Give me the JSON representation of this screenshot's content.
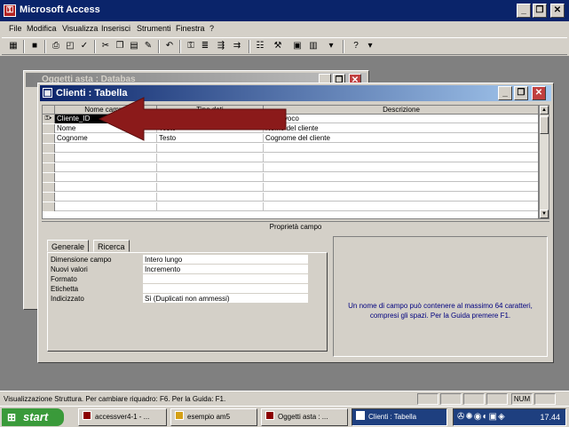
{
  "app": {
    "title": "Microsoft Access",
    "controls": {
      "minimize": "_",
      "restore": "❐",
      "close": "✕"
    }
  },
  "menu": [
    "File",
    "Modifica",
    "Visualizza",
    "Inserisci",
    "Strumenti",
    "Finestra",
    "?"
  ],
  "toolbar_icons": [
    "view-design-icon",
    "save-icon",
    "print-icon",
    "print-preview-icon",
    "spelling-icon",
    "cut-icon",
    "copy-icon",
    "paste-icon",
    "format-painter-icon",
    "undo-icon",
    "primary-key-icon",
    "indexes-icon",
    "insert-rows-icon",
    "delete-rows-icon",
    "properties-icon",
    "build-icon",
    "database-window-icon",
    "new-object-icon",
    "help-icon"
  ],
  "db_window": {
    "title": "Oggetti asta : Databas"
  },
  "table_window": {
    "title": "Clienti : Tabella",
    "columns": [
      "Nome campo",
      "Tipo dati",
      "Descrizione"
    ],
    "rows": [
      {
        "name": "Cliente_ID",
        "type": "",
        "description": "ID univoco",
        "key": true
      },
      {
        "name": "Nome",
        "type": "Testo",
        "description": "Nome del cliente",
        "key": false
      },
      {
        "name": "Cognome",
        "type": "Testo",
        "description": "Cognome del cliente",
        "key": false
      }
    ],
    "properties_label": "Proprietà campo",
    "tabs": [
      "Generale",
      "Ricerca"
    ],
    "properties": [
      {
        "label": "Dimensione campo",
        "value": "Intero lungo"
      },
      {
        "label": "Nuovi valori",
        "value": "Incremento"
      },
      {
        "label": "Formato",
        "value": ""
      },
      {
        "label": "Etichetta",
        "value": ""
      },
      {
        "label": "Indicizzato",
        "value": "Sì (Duplicati non ammessi)"
      }
    ],
    "help_text": "Un nome di campo può contenere al massimo 64 caratteri, compresi gli spazi. Per la Guida premere F1."
  },
  "status": {
    "text": "Visualizzazione Struttura. Per cambiare riquadro: F6. Per la Guida: F1.",
    "num": "NUM"
  },
  "taskbar": {
    "start": "start",
    "tasks": [
      "accessver4-1 - ...",
      "esempio am5",
      "Oggetti asta : ...",
      "Clienti : Tabella"
    ],
    "clock": "17.44"
  },
  "colors": {
    "desktop": "#008080",
    "titlebar_active": "#0a246a",
    "arrow": "#8b1a1a",
    "help_text": "#00007f"
  }
}
